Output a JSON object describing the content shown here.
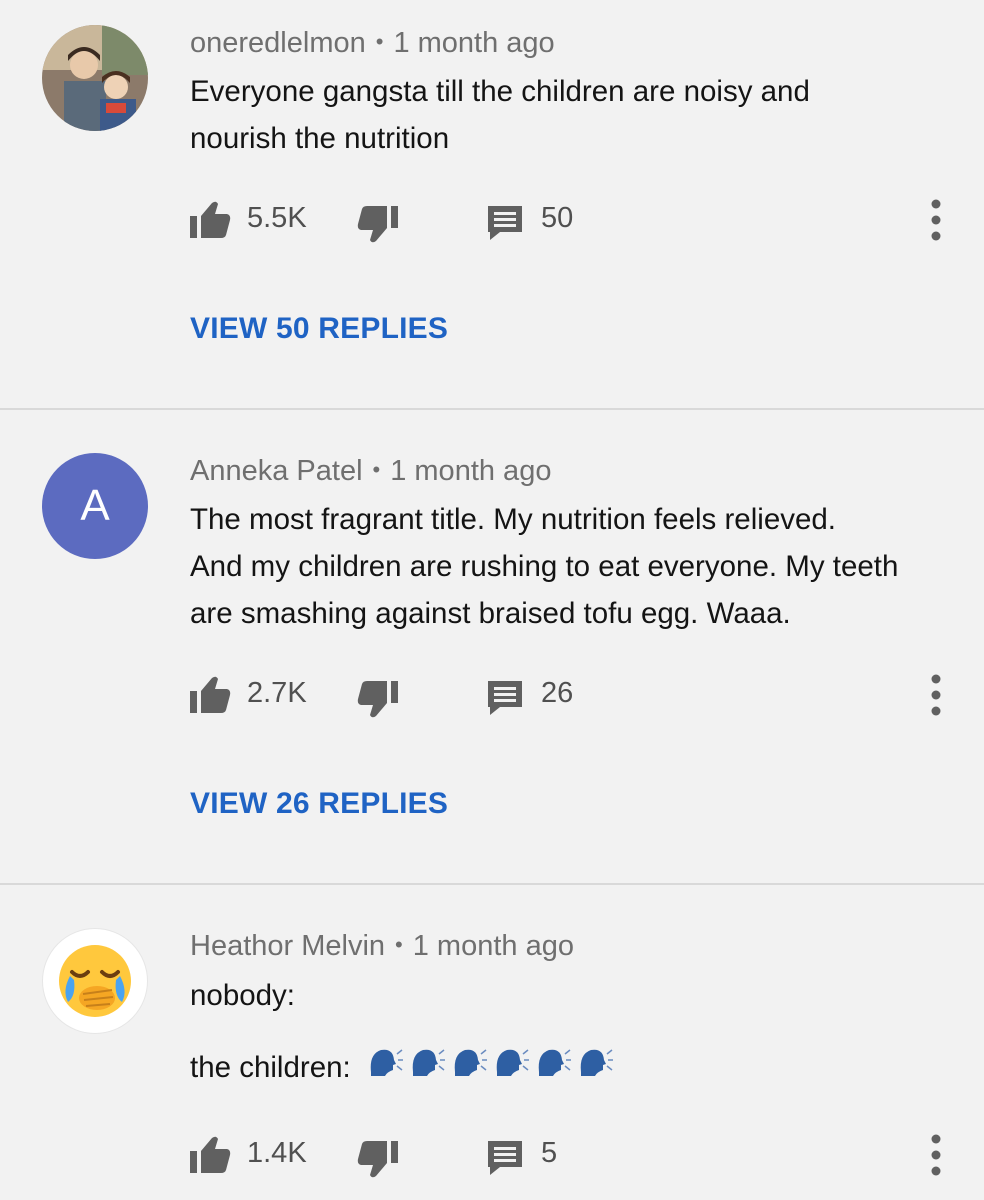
{
  "comments": [
    {
      "author": "oneredlelmon",
      "time": "1 month ago",
      "lines": [
        "Everyone gangsta till the children are noisy and",
        "nourish the nutrition"
      ],
      "likes": "5.5K",
      "replies": "50",
      "view_replies": "VIEW 50 REPLIES",
      "avatar_type": "photo"
    },
    {
      "author": "Anneka Patel",
      "time": "1 month ago",
      "lines": [
        "The most fragrant title.  My nutrition feels relieved.",
        "And my children are rushing to eat everyone. My teeth",
        "are smashing against braised tofu egg. Waaa."
      ],
      "likes": "2.7K",
      "replies": "26",
      "view_replies": "VIEW 26 REPLIES",
      "avatar_letter": "A",
      "avatar_color": "#5c6bc0"
    },
    {
      "author": "Heathor Melvin",
      "time": "1 month ago",
      "line1": "nobody:",
      "line2": "the children:",
      "emoji_repeat": 6,
      "emoji_name": "speaking-head-emoji",
      "likes": "1.4K",
      "replies": "5",
      "avatar_type": "face-with-hand-over-mouth-crying-emoji"
    }
  ],
  "icons": {
    "like": "thumbs-up-icon",
    "dislike": "thumbs-down-icon",
    "reply": "reply-comment-icon",
    "more": "more-vertical-icon"
  },
  "colors": {
    "background": "#f2f2f2",
    "link": "#1f63c4",
    "meta": "#6f6f6f",
    "icon": "#606060"
  }
}
